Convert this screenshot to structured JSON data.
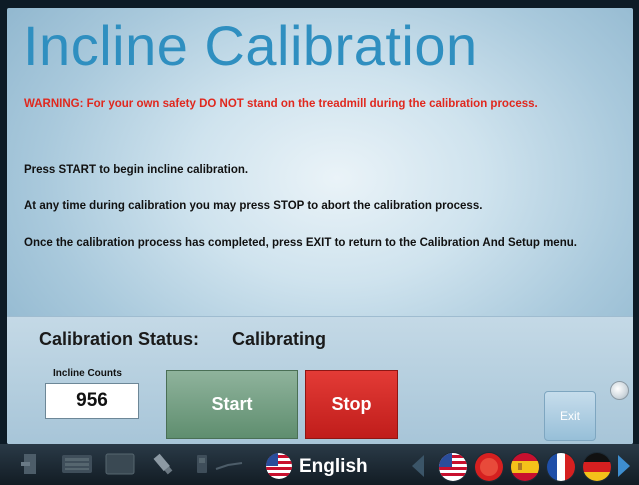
{
  "title": "Incline Calibration",
  "warning": "WARNING: For your own safety DO NOT stand on the treadmill during the calibration process.",
  "instructions": [
    "Press START to begin incline calibration.",
    "At any time during calibration you may press STOP to abort the calibration process.",
    "Once the calibration process has completed, press EXIT to return to the Calibration And Setup menu."
  ],
  "status": {
    "label": "Calibration Status:",
    "value": "Calibrating"
  },
  "incline_counts": {
    "label": "Incline Counts",
    "value": "956"
  },
  "buttons": {
    "start": "Start",
    "stop": "Stop",
    "exit": "Exit"
  },
  "taskbar": {
    "language": "English",
    "icons": [
      "exit-door-icon",
      "keypad-icon",
      "screen-icon",
      "usb-icon",
      "phone-icon",
      "headphones-icon"
    ],
    "flags": [
      "us-flag-icon",
      "japan-flag-icon",
      "spain-flag-icon",
      "france-flag-icon",
      "germany-flag-icon"
    ]
  },
  "colors": {
    "title": "#2f8fc0",
    "warning": "#e0281e",
    "start": "#5f8e6f",
    "stop": "#c01d1b"
  }
}
